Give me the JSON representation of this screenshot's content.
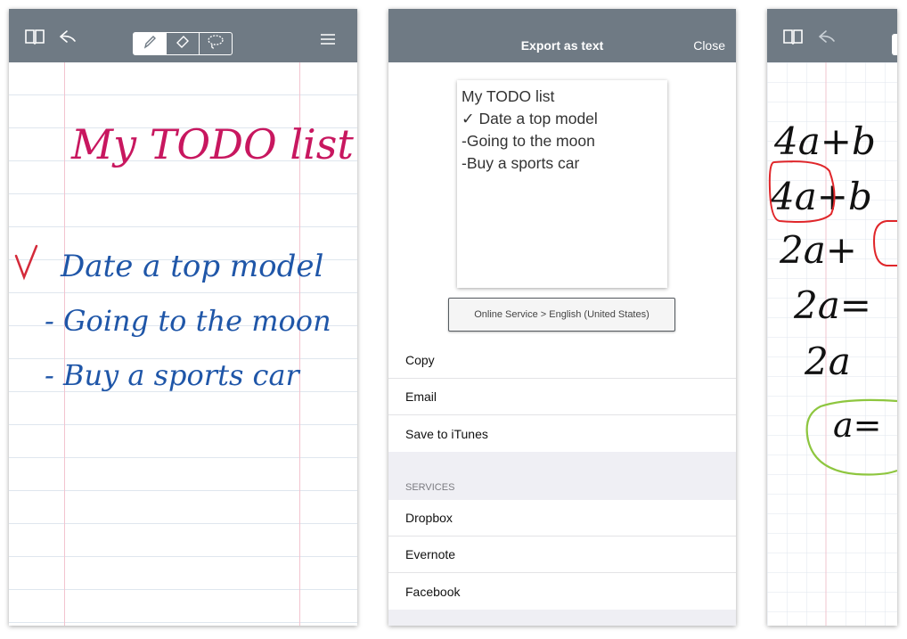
{
  "screen1": {
    "icons": [
      "book-icon",
      "undo-icon",
      "pen-icon",
      "eraser-icon",
      "lasso-icon",
      "menu-icon"
    ],
    "toolbar_color": "#6f7a84",
    "handwriting": {
      "title": "My TODO list",
      "items": [
        "✓ Date a top model",
        "- Going to the moon",
        "- Buy a sports car"
      ],
      "title_color": "#c8175f",
      "item_color": "#1f56a8",
      "check_color": "#d42a3a"
    }
  },
  "screen2": {
    "title": "Export as text",
    "close_label": "Close",
    "preview_lines": [
      "My TODO list",
      "✓ Date a top model",
      "-Going to the moon",
      "-Buy a sports car"
    ],
    "service_button": "Online Service > English (United States)",
    "actions": [
      "Copy",
      "Email",
      "Save to iTunes"
    ],
    "services_header": "SERVICES",
    "services": [
      "Dropbox",
      "Evernote",
      "Facebook"
    ]
  },
  "screen3": {
    "icons": [
      "book-icon",
      "undo-icon"
    ],
    "handwriting_lines": [
      "4a+b",
      "4a+b",
      "2a+",
      "2a=",
      "2a",
      "a="
    ],
    "ink_color": "#111111",
    "red_circle_color": "#e0262a",
    "green_circle_color": "#8ec63f"
  }
}
